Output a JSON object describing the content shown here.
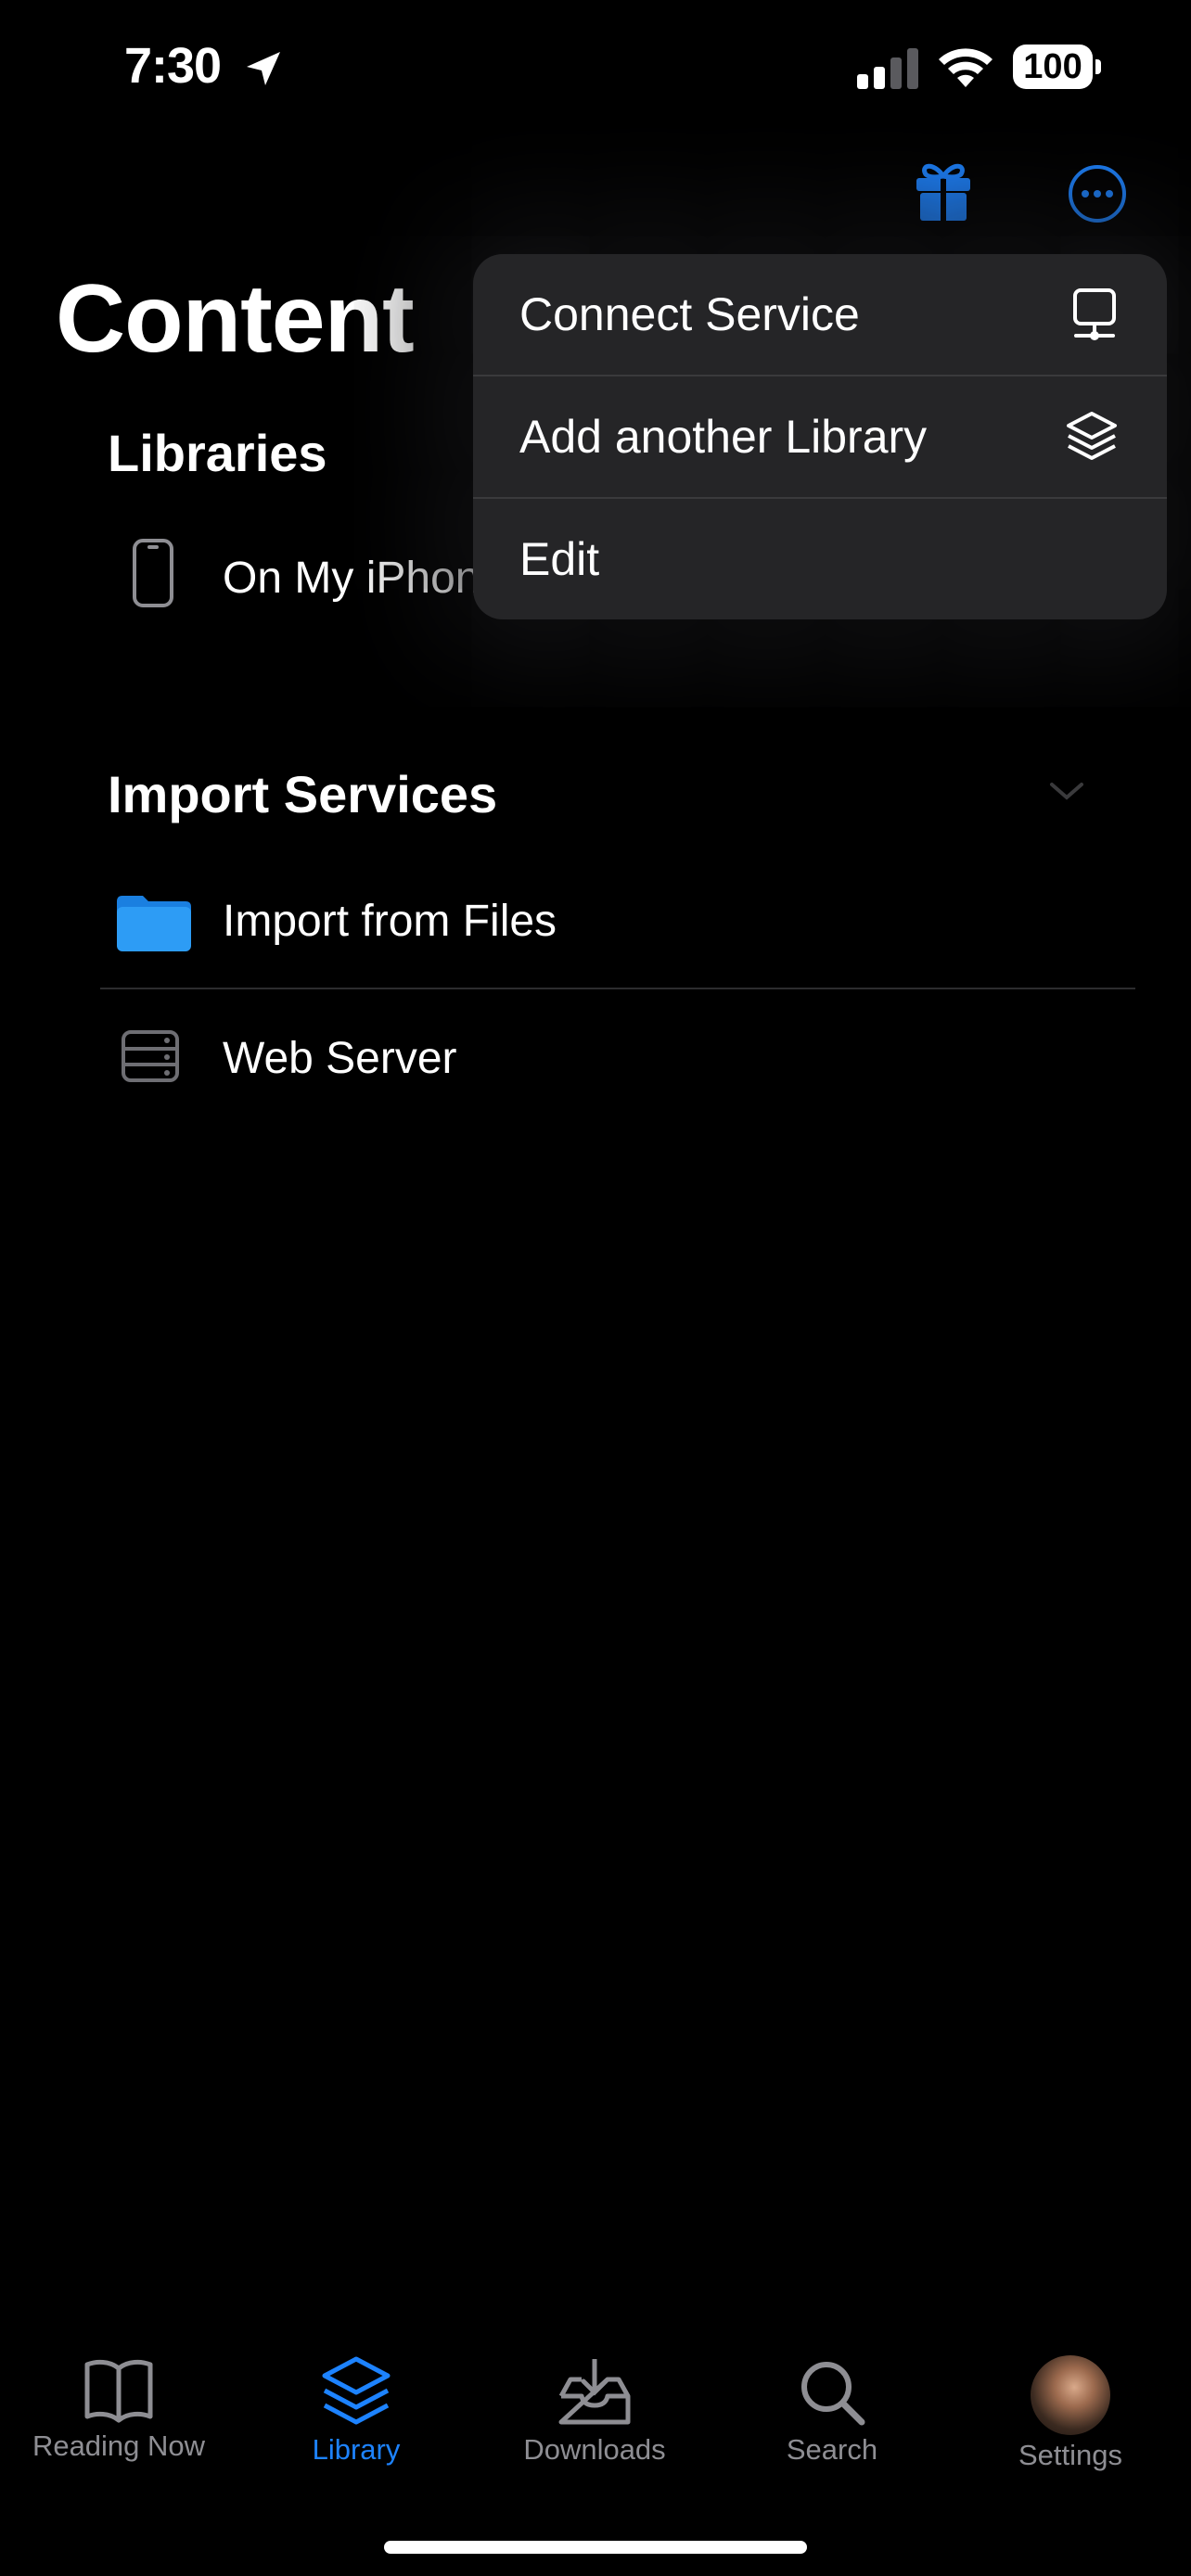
{
  "status": {
    "time": "7:30",
    "battery": "100"
  },
  "page": {
    "title": "Content"
  },
  "libraries": {
    "heading": "Libraries",
    "items": [
      {
        "label": "On My iPhone",
        "icon": "iphone-icon"
      }
    ]
  },
  "import_services": {
    "heading": "Import Services",
    "items": [
      {
        "label": "Import from Files",
        "icon": "folder-icon"
      },
      {
        "label": "Web Server",
        "icon": "server-icon"
      }
    ]
  },
  "menu": {
    "items": [
      {
        "label": "Connect Service",
        "icon": "desktop-icon"
      },
      {
        "label": "Add another Library",
        "icon": "layers-icon"
      },
      {
        "label": "Edit"
      }
    ]
  },
  "tabbar": {
    "items": [
      {
        "label": "Reading Now",
        "icon": "book-icon"
      },
      {
        "label": "Library",
        "icon": "layers-icon",
        "active": true
      },
      {
        "label": "Downloads",
        "icon": "tray-download-icon"
      },
      {
        "label": "Search",
        "icon": "magnifier-icon"
      },
      {
        "label": "Settings",
        "icon": "avatar"
      }
    ]
  },
  "colors": {
    "accent": "#1d83ff",
    "menu_bg": "#252527",
    "folder": "#2d9cf5"
  }
}
